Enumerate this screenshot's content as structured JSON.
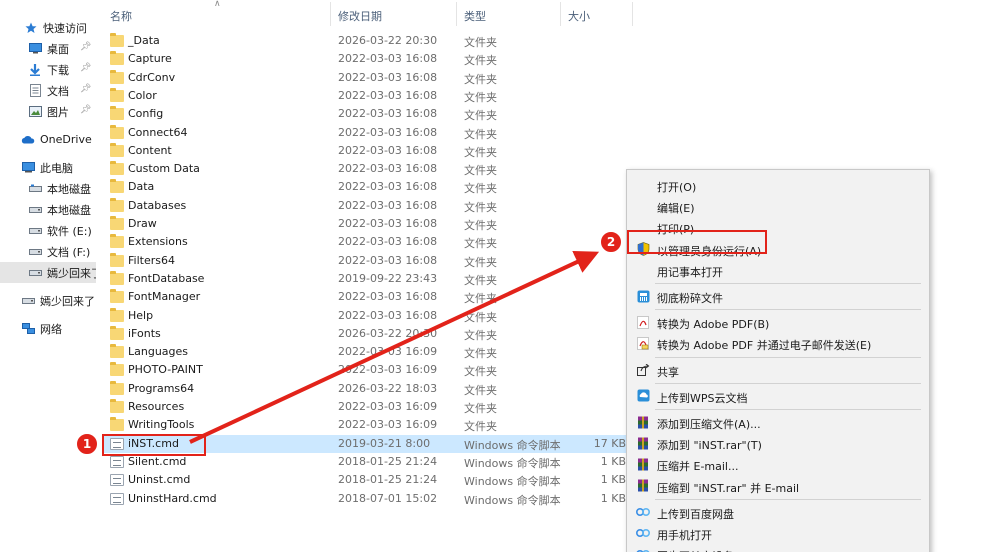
{
  "sidebar": {
    "items": [
      {
        "label": "快速访问",
        "icon": "star-icon",
        "pinned": false
      },
      {
        "label": "桌面",
        "icon": "desktop-icon",
        "pinned": true
      },
      {
        "label": "下载",
        "icon": "download-icon",
        "pinned": true
      },
      {
        "label": "文档",
        "icon": "document-icon",
        "pinned": true
      },
      {
        "label": "图片",
        "icon": "picture-icon",
        "pinned": true
      },
      {
        "label": "OneDrive",
        "icon": "cloud-icon",
        "pinned": false
      },
      {
        "label": "此电脑",
        "icon": "computer-icon",
        "pinned": false
      },
      {
        "label": "本地磁盘",
        "icon": "drive-icon",
        "pinned": false
      },
      {
        "label": "本地磁盘",
        "icon": "drive-icon",
        "pinned": false
      },
      {
        "label": "软件 (E:)",
        "icon": "drive-icon",
        "pinned": false
      },
      {
        "label": "文档 (F:)",
        "icon": "drive-icon",
        "pinned": false
      },
      {
        "label": "嫣少回来了",
        "icon": "drive-icon",
        "pinned": false,
        "selected": true
      },
      {
        "label": "嫣少回来了",
        "icon": "drive-icon",
        "pinned": false
      },
      {
        "label": "网络",
        "icon": "network-icon",
        "pinned": false
      }
    ]
  },
  "columns": {
    "name": "名称",
    "date": "修改日期",
    "type": "类型",
    "size": "大小"
  },
  "files": [
    {
      "name": "_Data",
      "date": "2026-03-22 20:30",
      "type": "文件夹",
      "size": "",
      "kind": "folder"
    },
    {
      "name": "Capture",
      "date": "2022-03-03 16:08",
      "type": "文件夹",
      "size": "",
      "kind": "folder"
    },
    {
      "name": "CdrConv",
      "date": "2022-03-03 16:08",
      "type": "文件夹",
      "size": "",
      "kind": "folder"
    },
    {
      "name": "Color",
      "date": "2022-03-03 16:08",
      "type": "文件夹",
      "size": "",
      "kind": "folder"
    },
    {
      "name": "Config",
      "date": "2022-03-03 16:08",
      "type": "文件夹",
      "size": "",
      "kind": "folder"
    },
    {
      "name": "Connect64",
      "date": "2022-03-03 16:08",
      "type": "文件夹",
      "size": "",
      "kind": "folder"
    },
    {
      "name": "Content",
      "date": "2022-03-03 16:08",
      "type": "文件夹",
      "size": "",
      "kind": "folder"
    },
    {
      "name": "Custom Data",
      "date": "2022-03-03 16:08",
      "type": "文件夹",
      "size": "",
      "kind": "folder"
    },
    {
      "name": "Data",
      "date": "2022-03-03 16:08",
      "type": "文件夹",
      "size": "",
      "kind": "folder"
    },
    {
      "name": "Databases",
      "date": "2022-03-03 16:08",
      "type": "文件夹",
      "size": "",
      "kind": "folder"
    },
    {
      "name": "Draw",
      "date": "2022-03-03 16:08",
      "type": "文件夹",
      "size": "",
      "kind": "folder"
    },
    {
      "name": "Extensions",
      "date": "2022-03-03 16:08",
      "type": "文件夹",
      "size": "",
      "kind": "folder"
    },
    {
      "name": "Filters64",
      "date": "2022-03-03 16:08",
      "type": "文件夹",
      "size": "",
      "kind": "folder"
    },
    {
      "name": "FontDatabase",
      "date": "2019-09-22 23:43",
      "type": "文件夹",
      "size": "",
      "kind": "folder"
    },
    {
      "name": "FontManager",
      "date": "2022-03-03 16:08",
      "type": "文件夹",
      "size": "",
      "kind": "folder"
    },
    {
      "name": "Help",
      "date": "2022-03-03 16:08",
      "type": "文件夹",
      "size": "",
      "kind": "folder"
    },
    {
      "name": "iFonts",
      "date": "2026-03-22 20:30",
      "type": "文件夹",
      "size": "",
      "kind": "folder"
    },
    {
      "name": "Languages",
      "date": "2022-03-03 16:09",
      "type": "文件夹",
      "size": "",
      "kind": "folder"
    },
    {
      "name": "PHOTO-PAINT",
      "date": "2022-03-03 16:09",
      "type": "文件夹",
      "size": "",
      "kind": "folder"
    },
    {
      "name": "Programs64",
      "date": "2026-03-22 18:03",
      "type": "文件夹",
      "size": "",
      "kind": "folder"
    },
    {
      "name": "Resources",
      "date": "2022-03-03 16:09",
      "type": "文件夹",
      "size": "",
      "kind": "folder"
    },
    {
      "name": "WritingTools",
      "date": "2022-03-03 16:09",
      "type": "文件夹",
      "size": "",
      "kind": "folder"
    },
    {
      "name": "iNST.cmd",
      "date": "2019-03-21 8:00",
      "type": "Windows 命令脚本",
      "size": "17 KB",
      "kind": "cmd",
      "selected": true
    },
    {
      "name": "Silent.cmd",
      "date": "2018-01-25 21:24",
      "type": "Windows 命令脚本",
      "size": "1 KB",
      "kind": "cmd"
    },
    {
      "name": "Uninst.cmd",
      "date": "2018-01-25 21:24",
      "type": "Windows 命令脚本",
      "size": "1 KB",
      "kind": "cmd"
    },
    {
      "name": "UninstHard.cmd",
      "date": "2018-07-01 15:02",
      "type": "Windows 命令脚本",
      "size": "1 KB",
      "kind": "cmd"
    }
  ],
  "context_menu": {
    "items": [
      {
        "label": "打开(O)",
        "icon": ""
      },
      {
        "label": "编辑(E)",
        "icon": ""
      },
      {
        "label": "打印(P)",
        "icon": ""
      },
      {
        "label": "以管理员身份运行(A)",
        "icon": "uac-shield-icon"
      },
      {
        "label": "用记事本打开",
        "icon": ""
      },
      {
        "sep": true
      },
      {
        "label": "彻底粉碎文件",
        "icon": "shredder-icon"
      },
      {
        "sep": true
      },
      {
        "label": "转换为 Adobe PDF(B)",
        "icon": "adobe-pdf-icon"
      },
      {
        "label": "转换为 Adobe PDF 并通过电子邮件发送(E)",
        "icon": "adobe-pdf-mail-icon"
      },
      {
        "sep": true
      },
      {
        "label": "共享",
        "icon": "share-icon"
      },
      {
        "sep": true
      },
      {
        "label": "上传到WPS云文档",
        "icon": "wps-cloud-icon"
      },
      {
        "sep": true
      },
      {
        "label": "添加到压缩文件(A)...",
        "icon": "winrar-icon"
      },
      {
        "label": "添加到 \"iNST.rar\"(T)",
        "icon": "winrar-icon"
      },
      {
        "label": "压缩并 E-mail...",
        "icon": "winrar-icon"
      },
      {
        "label": "压缩到 \"iNST.rar\" 并 E-mail",
        "icon": "winrar-icon"
      },
      {
        "sep": true
      },
      {
        "label": "上传到百度网盘",
        "icon": "baidu-netdisk-icon"
      },
      {
        "label": "用手机打开",
        "icon": "baidu-netdisk-icon"
      },
      {
        "label": "同步至其它设备",
        "icon": "baidu-netdisk-icon"
      }
    ]
  },
  "annotations": {
    "step1": "1",
    "step2": "2",
    "accent": "#e2231a"
  }
}
